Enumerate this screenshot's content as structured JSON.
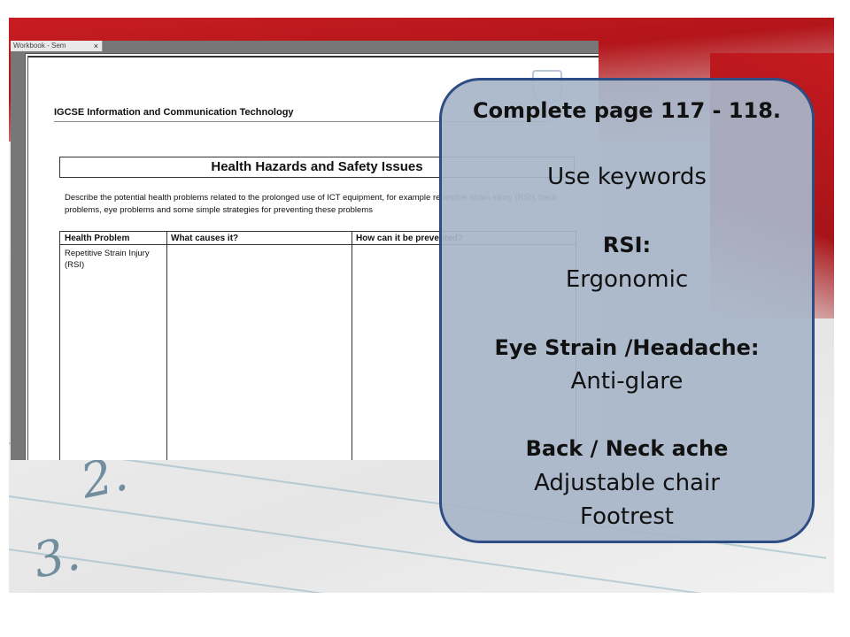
{
  "document": {
    "tab_label": "Workbook - Sem",
    "tab_close": "×",
    "header": "IGCSE Information and Communication Technology",
    "title": "Health Hazards and Safety Issues",
    "description": "Describe the potential health problems related to the prolonged use of ICT equipment, for example repetitive strain injury (RSI), back problems, eye problems and some simple strategies for preventing these problems",
    "table": {
      "headers": [
        "Health Problem",
        "What causes it?",
        "How can it be prevented?"
      ],
      "rows": [
        [
          "Repetitive Strain Injury (RSI)",
          "",
          ""
        ]
      ]
    }
  },
  "background": {
    "numerals": [
      "2.",
      "3."
    ]
  },
  "callout": {
    "heading": "Complete page 117 - 118.",
    "instruction": "Use keywords",
    "sections": [
      {
        "title": "RSI:",
        "items": [
          "Ergonomic"
        ]
      },
      {
        "title": "Eye Strain /Headache:",
        "items": [
          "Anti-glare"
        ]
      },
      {
        "title": "Back / Neck ache",
        "items": [
          "Adjustable chair",
          "Footrest"
        ]
      }
    ]
  },
  "colors": {
    "callout_fill": "#a8b6c8",
    "callout_border": "#2e4d85",
    "accent_red": "#c41a1f"
  }
}
